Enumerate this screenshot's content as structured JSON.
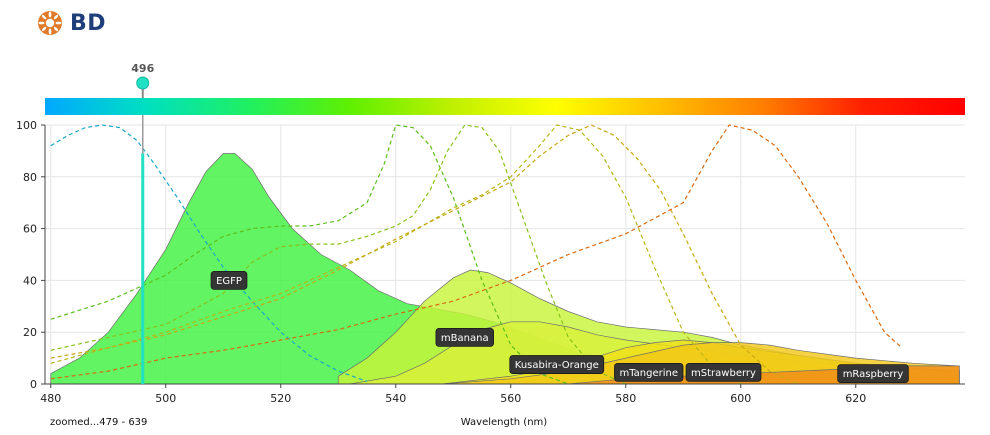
{
  "brand": {
    "logo_text": "BD",
    "logo_icon": "bd-starburst-icon",
    "color": "#1f3f7a",
    "icon_color": "#e07b2a"
  },
  "laser_marker": {
    "label": "496",
    "wavelength": 496,
    "color": "#22e0c4"
  },
  "footer": {
    "zoom_label": "zoomed...479 - 639"
  },
  "chart_data": {
    "type": "area",
    "xlabel": "Wavelength (nm)",
    "ylabel": "",
    "xlim": [
      479,
      639
    ],
    "ylim": [
      0,
      100
    ],
    "x_ticks": [
      480,
      500,
      520,
      540,
      560,
      580,
      600,
      620
    ],
    "y_ticks": [
      0,
      20,
      40,
      60,
      80,
      100
    ],
    "grid": true,
    "emission": [
      {
        "name": "EGFP",
        "color": "#3ff23f",
        "points": [
          [
            480,
            4
          ],
          [
            485,
            10
          ],
          [
            490,
            20
          ],
          [
            495,
            35
          ],
          [
            500,
            52
          ],
          [
            504,
            70
          ],
          [
            507,
            82
          ],
          [
            510,
            89
          ],
          [
            512,
            89
          ],
          [
            515,
            83
          ],
          [
            518,
            72
          ],
          [
            522,
            60
          ],
          [
            527,
            50
          ],
          [
            532,
            44
          ],
          [
            537,
            36
          ],
          [
            542,
            31
          ],
          [
            547,
            29
          ],
          [
            552,
            27
          ],
          [
            557,
            24
          ],
          [
            562,
            20
          ],
          [
            567,
            16
          ],
          [
            572,
            12
          ],
          [
            577,
            10
          ],
          [
            582,
            9
          ],
          [
            590,
            7
          ],
          [
            600,
            5
          ],
          [
            610,
            3.5
          ],
          [
            620,
            2.5
          ],
          [
            630,
            2
          ],
          [
            638,
            1.5
          ]
        ]
      },
      {
        "name": "mBanana",
        "color": "#c8f53a",
        "points": [
          [
            530,
            3
          ],
          [
            535,
            10
          ],
          [
            540,
            20
          ],
          [
            545,
            32
          ],
          [
            550,
            41
          ],
          [
            553,
            44
          ],
          [
            556,
            43
          ],
          [
            560,
            39
          ],
          [
            565,
            33
          ],
          [
            570,
            28
          ],
          [
            575,
            24
          ],
          [
            580,
            22
          ],
          [
            585,
            21
          ],
          [
            590,
            20
          ],
          [
            595,
            18
          ],
          [
            600,
            15
          ],
          [
            610,
            11
          ],
          [
            620,
            8
          ],
          [
            630,
            6
          ],
          [
            638,
            5
          ]
        ]
      },
      {
        "name": "Kusabira-Orange",
        "color": "#d9f03a",
        "points": [
          [
            532,
            0
          ],
          [
            540,
            3
          ],
          [
            545,
            8
          ],
          [
            550,
            15
          ],
          [
            555,
            21
          ],
          [
            560,
            24
          ],
          [
            565,
            24
          ],
          [
            570,
            22
          ],
          [
            575,
            19
          ],
          [
            580,
            17
          ],
          [
            590,
            14
          ],
          [
            600,
            11
          ],
          [
            610,
            9
          ],
          [
            620,
            7
          ],
          [
            630,
            6
          ],
          [
            638,
            5
          ]
        ]
      },
      {
        "name": "mTangerine",
        "color": "#f0de1a",
        "points": [
          [
            548,
            0
          ],
          [
            560,
            3
          ],
          [
            570,
            7
          ],
          [
            580,
            14
          ],
          [
            585,
            16
          ],
          [
            590,
            17
          ],
          [
            595,
            16
          ],
          [
            600,
            14
          ],
          [
            610,
            11
          ],
          [
            620,
            8
          ],
          [
            630,
            6
          ],
          [
            638,
            5
          ]
        ]
      },
      {
        "name": "mStrawberry",
        "color": "#f2c81a",
        "points": [
          [
            548,
            0
          ],
          [
            560,
            2
          ],
          [
            570,
            5
          ],
          [
            580,
            10
          ],
          [
            590,
            15
          ],
          [
            595,
            16
          ],
          [
            600,
            16
          ],
          [
            605,
            15
          ],
          [
            610,
            13
          ],
          [
            620,
            10
          ],
          [
            630,
            8
          ],
          [
            638,
            7
          ]
        ]
      },
      {
        "name": "mRaspberry",
        "color": "#f08c18",
        "points": [
          [
            570,
            0
          ],
          [
            580,
            2
          ],
          [
            590,
            3
          ],
          [
            600,
            4
          ],
          [
            610,
            5
          ],
          [
            620,
            6
          ],
          [
            625,
            7
          ],
          [
            630,
            7
          ],
          [
            638,
            7
          ]
        ]
      }
    ],
    "excitation": [
      {
        "color": "#1aa8c8",
        "points": [
          [
            480,
            92
          ],
          [
            483,
            96
          ],
          [
            486,
            99
          ],
          [
            489,
            100
          ],
          [
            492,
            99
          ],
          [
            495,
            94
          ],
          [
            498,
            85
          ],
          [
            502,
            72
          ],
          [
            506,
            58
          ],
          [
            510,
            45
          ],
          [
            515,
            32
          ],
          [
            520,
            20
          ],
          [
            525,
            11
          ],
          [
            530,
            5
          ],
          [
            535,
            1
          ]
        ]
      },
      {
        "color": "#5cbf1c",
        "points": [
          [
            480,
            25
          ],
          [
            490,
            32
          ],
          [
            500,
            42
          ],
          [
            505,
            50
          ],
          [
            510,
            57
          ],
          [
            515,
            60
          ],
          [
            520,
            61
          ],
          [
            525,
            61
          ],
          [
            530,
            63
          ],
          [
            535,
            70
          ],
          [
            538,
            85
          ],
          [
            540,
            100
          ],
          [
            543,
            99
          ],
          [
            546,
            92
          ],
          [
            550,
            72
          ],
          [
            555,
            40
          ],
          [
            560,
            15
          ],
          [
            565,
            4
          ],
          [
            570,
            0
          ]
        ]
      },
      {
        "color": "#8ac21a",
        "points": [
          [
            480,
            13
          ],
          [
            490,
            18
          ],
          [
            500,
            23
          ],
          [
            510,
            35
          ],
          [
            515,
            47
          ],
          [
            520,
            53
          ],
          [
            525,
            54
          ],
          [
            530,
            54
          ],
          [
            535,
            57
          ],
          [
            540,
            61
          ],
          [
            543,
            65
          ],
          [
            546,
            75
          ],
          [
            549,
            90
          ],
          [
            552,
            100
          ],
          [
            555,
            99
          ],
          [
            558,
            90
          ],
          [
            562,
            65
          ],
          [
            566,
            40
          ],
          [
            570,
            18
          ],
          [
            575,
            5
          ],
          [
            580,
            0
          ]
        ]
      },
      {
        "color": "#b5b818",
        "points": [
          [
            480,
            8
          ],
          [
            490,
            14
          ],
          [
            500,
            20
          ],
          [
            510,
            28
          ],
          [
            520,
            35
          ],
          [
            530,
            45
          ],
          [
            540,
            55
          ],
          [
            550,
            68
          ],
          [
            555,
            73
          ],
          [
            560,
            80
          ],
          [
            565,
            92
          ],
          [
            568,
            100
          ],
          [
            572,
            98
          ],
          [
            576,
            88
          ],
          [
            580,
            72
          ],
          [
            585,
            45
          ],
          [
            590,
            20
          ],
          [
            595,
            7
          ],
          [
            600,
            0
          ]
        ]
      },
      {
        "color": "#c8a818",
        "points": [
          [
            480,
            10
          ],
          [
            490,
            14
          ],
          [
            500,
            19
          ],
          [
            510,
            26
          ],
          [
            520,
            33
          ],
          [
            530,
            44
          ],
          [
            540,
            56
          ],
          [
            550,
            67
          ],
          [
            560,
            78
          ],
          [
            565,
            88
          ],
          [
            570,
            96
          ],
          [
            574,
            100
          ],
          [
            578,
            96
          ],
          [
            582,
            87
          ],
          [
            586,
            75
          ],
          [
            590,
            58
          ],
          [
            595,
            35
          ],
          [
            600,
            15
          ],
          [
            605,
            5
          ],
          [
            610,
            0
          ]
        ]
      },
      {
        "color": "#d96a12",
        "points": [
          [
            480,
            2
          ],
          [
            490,
            5
          ],
          [
            500,
            10
          ],
          [
            510,
            13
          ],
          [
            520,
            17
          ],
          [
            530,
            21
          ],
          [
            540,
            27
          ],
          [
            550,
            32
          ],
          [
            560,
            40
          ],
          [
            570,
            50
          ],
          [
            580,
            58
          ],
          [
            590,
            70
          ],
          [
            595,
            90
          ],
          [
            598,
            100
          ],
          [
            602,
            98
          ],
          [
            606,
            92
          ],
          [
            610,
            80
          ],
          [
            615,
            62
          ],
          [
            620,
            40
          ],
          [
            625,
            20
          ],
          [
            628,
            14
          ]
        ]
      }
    ],
    "label_positions": [
      {
        "name": "EGFP",
        "x": 511,
        "y": 40
      },
      {
        "name": "mBanana",
        "x": 552,
        "y": 18
      },
      {
        "name": "Kusabira-Orange",
        "x": 568,
        "y": 7.5
      },
      {
        "name": "mTangerine",
        "x": 584,
        "y": 4.5
      },
      {
        "name": "mStrawberry",
        "x": 597,
        "y": 4.5
      },
      {
        "name": "mRaspberry",
        "x": 623,
        "y": 4
      }
    ],
    "spectrum_gradient": [
      "#00a8ff",
      "#00e0c0",
      "#20f060",
      "#60f000",
      "#c0f000",
      "#ffff00",
      "#ffc000",
      "#ff8000",
      "#ff2000",
      "#ff0000"
    ]
  }
}
